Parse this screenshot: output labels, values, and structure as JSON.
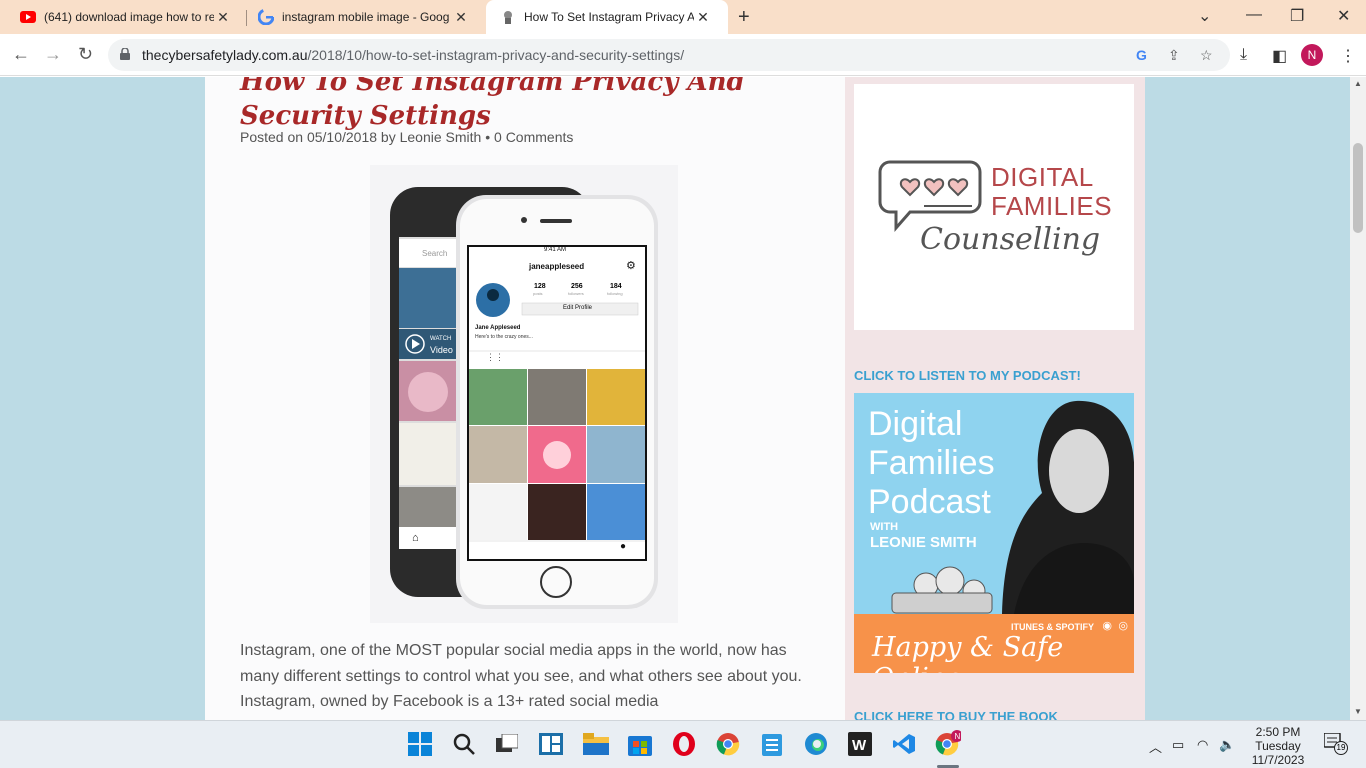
{
  "browser": {
    "tabs": [
      {
        "title": "(641) download image how to re",
        "favicon": "youtube-icon",
        "active": false
      },
      {
        "title": "instagram mobile image - Goog",
        "favicon": "google-icon",
        "active": false
      },
      {
        "title": "How To Set Instagram Privacy Ar",
        "favicon": "site-icon",
        "active": true
      }
    ],
    "new_tab_label": "+",
    "url_domain": "thecybersafetylady.com.au",
    "url_path": "/2018/10/how-to-set-instagram-privacy-and-security-settings/",
    "profile_initial": "N"
  },
  "post": {
    "title": "How To Set Instagram Privacy And Security Settings",
    "meta_prefix": "Posted on",
    "date": "05/10/2018",
    "by": "by",
    "author": "Leonie Smith",
    "bullet": "•",
    "comments": "0 Comments",
    "intro": "Instagram, one of the MOST popular social media apps in the world, now has many different settings to control what you see, and what others see about you. Instagram, owned by Facebook is a 13+ rated social media"
  },
  "phone": {
    "time": "9:41 AM",
    "username": "janeappleseed",
    "posts": "128",
    "posts_label": "posts",
    "followers": "256",
    "followers_label": "followers",
    "following": "184",
    "following_label": "following",
    "edit_profile": "Edit Profile",
    "name": "Jane Appleseed",
    "bio": "Here's to the crazy ones...",
    "back_search": "Search",
    "back_watch": "WATCH",
    "back_video": "Video"
  },
  "sidebar": {
    "logo_line1": "DIGITAL",
    "logo_line2": "FAMILIES",
    "logo_line3": "Counselling",
    "podcast_link": "CLICK TO LISTEN TO MY PODCAST!",
    "podcast_title_lines": [
      "Digital",
      "Families",
      "Podcast"
    ],
    "podcast_with": "WITH",
    "podcast_host": "LEONIE SMITH",
    "podcast_itunes": "ITUNES & SPOTIFY",
    "podcast_tagline": "Happy & Safe Online",
    "buy_link": "CLICK HERE TO BUY THE BOOK"
  },
  "taskbar": {
    "time": "2:50 PM",
    "day": "Tuesday",
    "date": "11/7/2023",
    "notifications": "19",
    "apps": [
      "windows-start-icon",
      "search-icon",
      "task-view-icon",
      "widgets-icon",
      "file-explorer-icon",
      "microsoft-store-icon",
      "opera-icon",
      "chrome-icon",
      "notepad-icon",
      "edge-icon",
      "wps-writer-icon",
      "vscode-icon",
      "chrome-profile-icon"
    ]
  },
  "colors": {
    "tabbar": "#f9dfc9",
    "page_bg": "#bcdbe5",
    "title_red": "#a82828",
    "link_blue": "#3aa0d0",
    "podcast_blue": "#8fd3ef",
    "podcast_orange": "#f7924a"
  }
}
